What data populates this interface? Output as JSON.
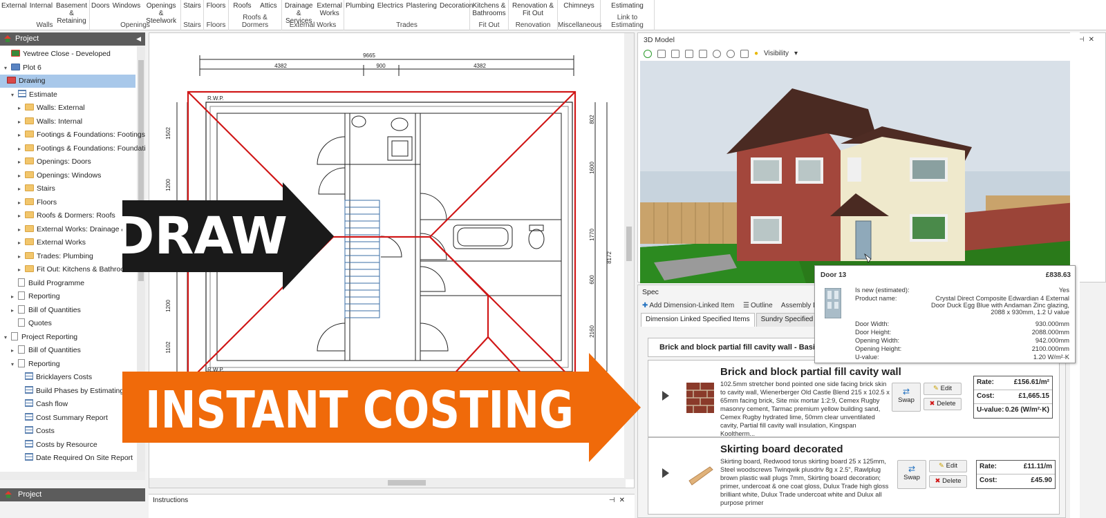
{
  "ribbon": {
    "groups": [
      {
        "name": "Walls",
        "items": [
          "External",
          "Internal",
          "Basement & Retaining"
        ]
      },
      {
        "name": "Openings",
        "items": [
          "Doors",
          "Windows",
          "Openings & Steelwork"
        ]
      },
      {
        "name": "Stairs",
        "items": [
          "Stairs"
        ]
      },
      {
        "name": "Floors",
        "items": [
          "Floors"
        ]
      },
      {
        "name": "Roofs & Dormers",
        "items": [
          "Roofs",
          "Attics"
        ]
      },
      {
        "name": "External Works",
        "items": [
          "Drainage & Services",
          "External Works"
        ]
      },
      {
        "name": "Trades",
        "items": [
          "Plumbing",
          "Electrics",
          "Plastering",
          "Decoration"
        ]
      },
      {
        "name": "Fit Out",
        "items": [
          "Kitchens & Bathrooms"
        ]
      },
      {
        "name": "Renovation",
        "items": [
          "Renovation & Fit Out"
        ]
      },
      {
        "name": "Miscellaneous",
        "items": [
          "Chimneys"
        ]
      },
      {
        "name": "Link to Estimating",
        "items": [
          "Estimating"
        ]
      }
    ]
  },
  "left_panel": {
    "title": "Project",
    "bottom_title": "Project",
    "tree": [
      {
        "label": "Yewtree Close - Developed",
        "icon": "house",
        "indent": 0,
        "arrow": ""
      },
      {
        "label": "Plot 6",
        "icon": "folder-blue",
        "indent": 0,
        "arrow": "▾"
      },
      {
        "label": "Drawing",
        "icon": "pencil",
        "indent": 1,
        "arrow": "",
        "selected": true
      },
      {
        "label": "Estimate",
        "icon": "grid",
        "indent": 1,
        "arrow": "▾"
      },
      {
        "label": "Walls: External",
        "icon": "folder",
        "indent": 2,
        "arrow": "▸"
      },
      {
        "label": "Walls: Internal",
        "icon": "folder",
        "indent": 2,
        "arrow": "▸"
      },
      {
        "label": "Footings & Foundations: Footings",
        "icon": "folder",
        "indent": 2,
        "arrow": "▸"
      },
      {
        "label": "Footings & Foundations: Foundation",
        "icon": "folder",
        "indent": 2,
        "arrow": "▸"
      },
      {
        "label": "Openings: Doors",
        "icon": "folder",
        "indent": 2,
        "arrow": "▸"
      },
      {
        "label": "Openings: Windows",
        "icon": "folder",
        "indent": 2,
        "arrow": "▸"
      },
      {
        "label": "Stairs",
        "icon": "folder",
        "indent": 2,
        "arrow": "▸"
      },
      {
        "label": "Floors",
        "icon": "folder",
        "indent": 2,
        "arrow": "▸"
      },
      {
        "label": "Roofs & Dormers: Roofs",
        "icon": "folder",
        "indent": 2,
        "arrow": "▸"
      },
      {
        "label": "External Works: Drainage & Serv",
        "icon": "folder",
        "indent": 2,
        "arrow": "▸"
      },
      {
        "label": "External Works",
        "icon": "folder",
        "indent": 2,
        "arrow": "▸"
      },
      {
        "label": "Trades: Plumbing",
        "icon": "folder",
        "indent": 2,
        "arrow": "▸"
      },
      {
        "label": "Fit Out: Kitchens & Bathrooms",
        "icon": "folder",
        "indent": 2,
        "arrow": "▸"
      },
      {
        "label": "Build Programme",
        "icon": "doc",
        "indent": 1,
        "arrow": ""
      },
      {
        "label": "Reporting",
        "icon": "doc",
        "indent": 1,
        "arrow": "▸"
      },
      {
        "label": "Bill of Quantities",
        "icon": "doc",
        "indent": 1,
        "arrow": "▸"
      },
      {
        "label": "Quotes",
        "icon": "doc",
        "indent": 1,
        "arrow": ""
      },
      {
        "label": "Project Reporting",
        "icon": "doc",
        "indent": 0,
        "arrow": "▾"
      },
      {
        "label": "Bill of Quantities",
        "icon": "doc",
        "indent": 1,
        "arrow": "▸"
      },
      {
        "label": "Reporting",
        "icon": "doc",
        "indent": 1,
        "arrow": "▾"
      },
      {
        "label": "Bricklayers Costs",
        "icon": "grid",
        "indent": 2,
        "arrow": ""
      },
      {
        "label": "Build Phases by Estimating Calcu",
        "icon": "grid",
        "indent": 2,
        "arrow": ""
      },
      {
        "label": "Cash flow",
        "icon": "grid",
        "indent": 2,
        "arrow": ""
      },
      {
        "label": "Cost Summary Report",
        "icon": "grid",
        "indent": 2,
        "arrow": ""
      },
      {
        "label": "Costs",
        "icon": "grid",
        "indent": 2,
        "arrow": ""
      },
      {
        "label": "Costs by Resource",
        "icon": "grid",
        "indent": 2,
        "arrow": ""
      },
      {
        "label": "Date Required On Site Report",
        "icon": "grid",
        "indent": 2,
        "arrow": ""
      }
    ]
  },
  "drawing": {
    "dim_total": "9665",
    "dim_top": [
      "4382",
      "900",
      "4382"
    ],
    "dim_left": [
      "1502",
      "1200",
      "1200",
      "1102"
    ],
    "dim_right": [
      "802",
      "1600",
      "1770",
      "600",
      "2160"
    ],
    "dim_overall_right": "8172",
    "rwp_top": "R.W.P.",
    "rwp_bottom": "R.W.P."
  },
  "banners": {
    "draw": "DRAW",
    "costing": "INSTANT COSTING",
    "draw_color": "#1a1a1a",
    "costing_color": "#f06a0a"
  },
  "instructions": {
    "title": "Instructions"
  },
  "model3d": {
    "title": "3D Model",
    "visibility": "Visibility"
  },
  "tooltip": {
    "title": "Door 13",
    "price": "£838.63",
    "rows": [
      {
        "k": "Is new (estimated):",
        "v": "Yes"
      },
      {
        "k": "Product name:",
        "v": "Crystal Direct Composite Edwardian 4 External Door Duck Egg Blue with Andaman Zinc glazing, 2088 x 930mm, 1.2 U value"
      },
      {
        "k": "Door Width:",
        "v": "930.000mm"
      },
      {
        "k": "Door Height:",
        "v": "2088.000mm"
      },
      {
        "k": "Opening Width:",
        "v": "942.000mm"
      },
      {
        "k": "Opening Height:",
        "v": "2100.000mm"
      },
      {
        "k": "U-value:",
        "v": "1.20 W/m²·K"
      }
    ]
  },
  "spec": {
    "title": "Spec",
    "tools": [
      "Add Dimension-Linked Item",
      "Outline",
      "Assembly De"
    ],
    "tabs": [
      "Dimension Linked Specified Items",
      "Sundry Specified Items"
    ],
    "group": "Brick and block partial fill cavity wall - Basic The",
    "cards": [
      {
        "title": "Brick and block partial fill cavity wall",
        "desc": "102.5mm stretcher bond pointed one side facing brick skin to cavity wall, Wienerberger Old Castle Blend 215 x 102.5 x 65mm facing brick, Site mix mortar 1:2:9, Cemex Rugby masonry cement, Tarmac premium yellow building sand, Cemex Rugby hydrated lime, 50mm clear unventilated cavity, Partial fill cavity wall insulation, Kingspan Kooltherm...",
        "swap": "Swap",
        "edit": "Edit",
        "delete": "Delete",
        "rate_label": "Rate:",
        "rate": "£156.61/m²",
        "cost_label": "Cost:",
        "cost": "£1,665.15",
        "u_label": "U-value:",
        "u": "0.26 (W/m²·K)"
      },
      {
        "title": "Skirting board decorated",
        "desc": "Skirting board, Redwood torus skirting board 25 x 125mm, Steel woodscrews Twinqwik plusdriv 8g x 2.5\", Rawlplug brown plastic wall plugs 7mm, Skirting board decoration; primer, undercoat & one coat gloss, Dulux Trade high gloss brilliant white, Dulux Trade undercoat white and Dulux all purpose primer",
        "swap": "Swap",
        "edit": "Edit",
        "delete": "Delete",
        "rate_label": "Rate:",
        "rate": "£11.11/m",
        "cost_label": "Cost:",
        "cost": "£45.90"
      }
    ]
  }
}
